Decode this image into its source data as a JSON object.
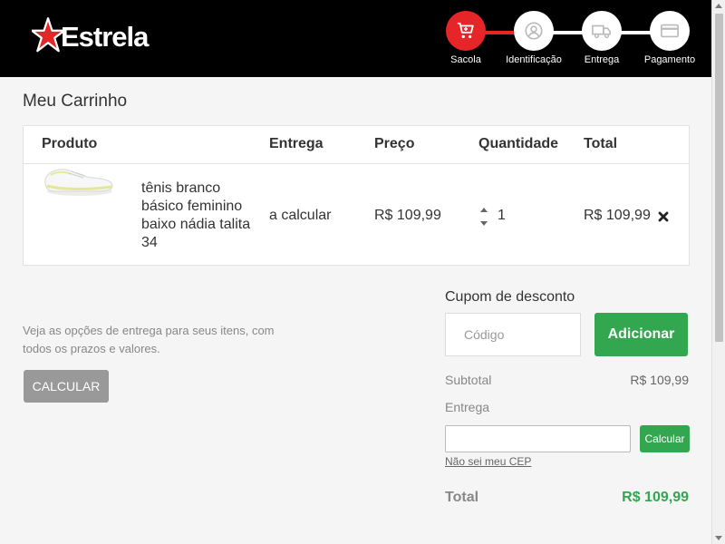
{
  "brand": {
    "name": "Estrela",
    "accent": "#e52528"
  },
  "steps": [
    {
      "label": "Sacola",
      "icon": "cart-icon",
      "active": true
    },
    {
      "label": "Identificação",
      "icon": "user-icon",
      "active": false
    },
    {
      "label": "Entrega",
      "icon": "truck-icon",
      "active": false
    },
    {
      "label": "Pagamento",
      "icon": "card-icon",
      "active": false
    }
  ],
  "page_title": "Meu Carrinho",
  "table": {
    "headers": {
      "product": "Produto",
      "delivery": "Entrega",
      "price": "Preço",
      "quantity": "Quantidade",
      "total": "Total"
    },
    "items": [
      {
        "name": "tênis branco básico feminino baixo nádia talita 34",
        "delivery": "a calcular",
        "price": "R$ 109,99",
        "quantity": "1",
        "total": "R$ 109,99"
      }
    ]
  },
  "delivery_note": "Veja as opções de entrega para seus itens, com todos os prazos e valores.",
  "calc_button": "CALCULAR",
  "coupon": {
    "label": "Cupom de desconto",
    "placeholder": "Código",
    "button": "Adicionar"
  },
  "summary": {
    "subtotal_label": "Subtotal",
    "subtotal_value": "R$ 109,99",
    "delivery_label": "Entrega",
    "cep_button": "Calcular",
    "cep_link": "Não sei meu CEP",
    "total_label": "Total",
    "total_value": "R$ 109,99"
  },
  "colors": {
    "header_bg": "#000000",
    "green": "#33a650",
    "red": "#e52528"
  }
}
